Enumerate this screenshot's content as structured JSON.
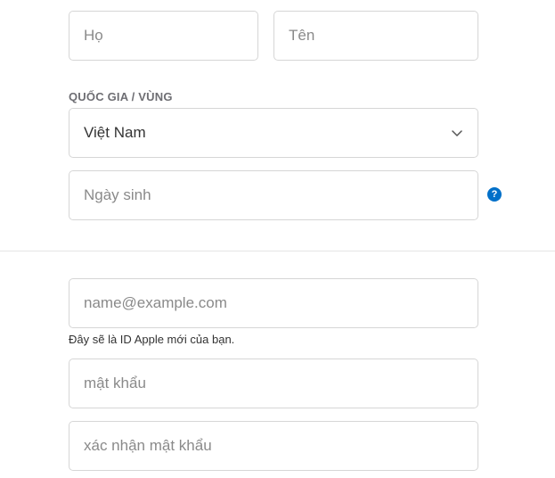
{
  "name": {
    "first_placeholder": "Họ",
    "last_placeholder": "Tên"
  },
  "country": {
    "label": "QUỐC GIA / VÙNG",
    "selected": "Việt Nam"
  },
  "birthday": {
    "placeholder": "Ngày sinh",
    "help_glyph": "?"
  },
  "email": {
    "placeholder": "name@example.com",
    "hint": "Đây sẽ là ID Apple mới của bạn."
  },
  "password": {
    "placeholder": "mật khẩu",
    "confirm_placeholder": "xác nhận mật khẩu"
  },
  "colors": {
    "accent": "#0070c9",
    "border": "#d6d6d6",
    "placeholder": "#8a8a8a"
  }
}
